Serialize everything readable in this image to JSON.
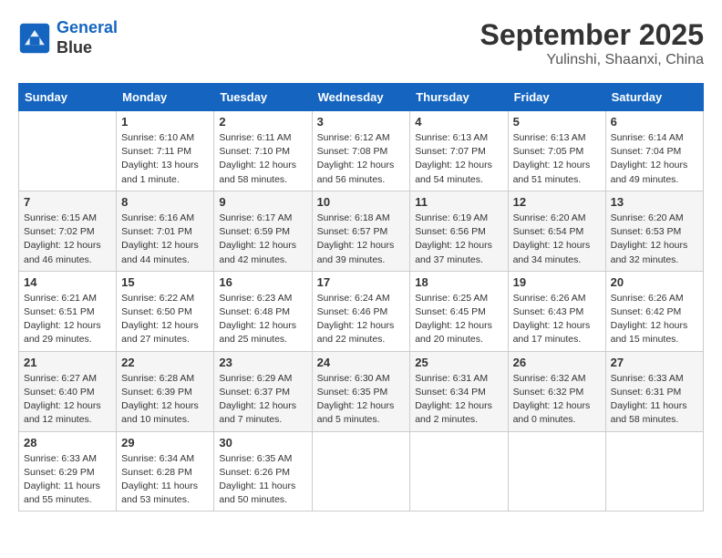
{
  "header": {
    "logo_line1": "General",
    "logo_line2": "Blue",
    "title": "September 2025",
    "subtitle": "Yulinshi, Shaanxi, China"
  },
  "weekdays": [
    "Sunday",
    "Monday",
    "Tuesday",
    "Wednesday",
    "Thursday",
    "Friday",
    "Saturday"
  ],
  "weeks": [
    [
      {
        "day": "",
        "info": ""
      },
      {
        "day": "1",
        "info": "Sunrise: 6:10 AM\nSunset: 7:11 PM\nDaylight: 13 hours\nand 1 minute."
      },
      {
        "day": "2",
        "info": "Sunrise: 6:11 AM\nSunset: 7:10 PM\nDaylight: 12 hours\nand 58 minutes."
      },
      {
        "day": "3",
        "info": "Sunrise: 6:12 AM\nSunset: 7:08 PM\nDaylight: 12 hours\nand 56 minutes."
      },
      {
        "day": "4",
        "info": "Sunrise: 6:13 AM\nSunset: 7:07 PM\nDaylight: 12 hours\nand 54 minutes."
      },
      {
        "day": "5",
        "info": "Sunrise: 6:13 AM\nSunset: 7:05 PM\nDaylight: 12 hours\nand 51 minutes."
      },
      {
        "day": "6",
        "info": "Sunrise: 6:14 AM\nSunset: 7:04 PM\nDaylight: 12 hours\nand 49 minutes."
      }
    ],
    [
      {
        "day": "7",
        "info": "Sunrise: 6:15 AM\nSunset: 7:02 PM\nDaylight: 12 hours\nand 46 minutes."
      },
      {
        "day": "8",
        "info": "Sunrise: 6:16 AM\nSunset: 7:01 PM\nDaylight: 12 hours\nand 44 minutes."
      },
      {
        "day": "9",
        "info": "Sunrise: 6:17 AM\nSunset: 6:59 PM\nDaylight: 12 hours\nand 42 minutes."
      },
      {
        "day": "10",
        "info": "Sunrise: 6:18 AM\nSunset: 6:57 PM\nDaylight: 12 hours\nand 39 minutes."
      },
      {
        "day": "11",
        "info": "Sunrise: 6:19 AM\nSunset: 6:56 PM\nDaylight: 12 hours\nand 37 minutes."
      },
      {
        "day": "12",
        "info": "Sunrise: 6:20 AM\nSunset: 6:54 PM\nDaylight: 12 hours\nand 34 minutes."
      },
      {
        "day": "13",
        "info": "Sunrise: 6:20 AM\nSunset: 6:53 PM\nDaylight: 12 hours\nand 32 minutes."
      }
    ],
    [
      {
        "day": "14",
        "info": "Sunrise: 6:21 AM\nSunset: 6:51 PM\nDaylight: 12 hours\nand 29 minutes."
      },
      {
        "day": "15",
        "info": "Sunrise: 6:22 AM\nSunset: 6:50 PM\nDaylight: 12 hours\nand 27 minutes."
      },
      {
        "day": "16",
        "info": "Sunrise: 6:23 AM\nSunset: 6:48 PM\nDaylight: 12 hours\nand 25 minutes."
      },
      {
        "day": "17",
        "info": "Sunrise: 6:24 AM\nSunset: 6:46 PM\nDaylight: 12 hours\nand 22 minutes."
      },
      {
        "day": "18",
        "info": "Sunrise: 6:25 AM\nSunset: 6:45 PM\nDaylight: 12 hours\nand 20 minutes."
      },
      {
        "day": "19",
        "info": "Sunrise: 6:26 AM\nSunset: 6:43 PM\nDaylight: 12 hours\nand 17 minutes."
      },
      {
        "day": "20",
        "info": "Sunrise: 6:26 AM\nSunset: 6:42 PM\nDaylight: 12 hours\nand 15 minutes."
      }
    ],
    [
      {
        "day": "21",
        "info": "Sunrise: 6:27 AM\nSunset: 6:40 PM\nDaylight: 12 hours\nand 12 minutes."
      },
      {
        "day": "22",
        "info": "Sunrise: 6:28 AM\nSunset: 6:39 PM\nDaylight: 12 hours\nand 10 minutes."
      },
      {
        "day": "23",
        "info": "Sunrise: 6:29 AM\nSunset: 6:37 PM\nDaylight: 12 hours\nand 7 minutes."
      },
      {
        "day": "24",
        "info": "Sunrise: 6:30 AM\nSunset: 6:35 PM\nDaylight: 12 hours\nand 5 minutes."
      },
      {
        "day": "25",
        "info": "Sunrise: 6:31 AM\nSunset: 6:34 PM\nDaylight: 12 hours\nand 2 minutes."
      },
      {
        "day": "26",
        "info": "Sunrise: 6:32 AM\nSunset: 6:32 PM\nDaylight: 12 hours\nand 0 minutes."
      },
      {
        "day": "27",
        "info": "Sunrise: 6:33 AM\nSunset: 6:31 PM\nDaylight: 11 hours\nand 58 minutes."
      }
    ],
    [
      {
        "day": "28",
        "info": "Sunrise: 6:33 AM\nSunset: 6:29 PM\nDaylight: 11 hours\nand 55 minutes."
      },
      {
        "day": "29",
        "info": "Sunrise: 6:34 AM\nSunset: 6:28 PM\nDaylight: 11 hours\nand 53 minutes."
      },
      {
        "day": "30",
        "info": "Sunrise: 6:35 AM\nSunset: 6:26 PM\nDaylight: 11 hours\nand 50 minutes."
      },
      {
        "day": "",
        "info": ""
      },
      {
        "day": "",
        "info": ""
      },
      {
        "day": "",
        "info": ""
      },
      {
        "day": "",
        "info": ""
      }
    ]
  ]
}
